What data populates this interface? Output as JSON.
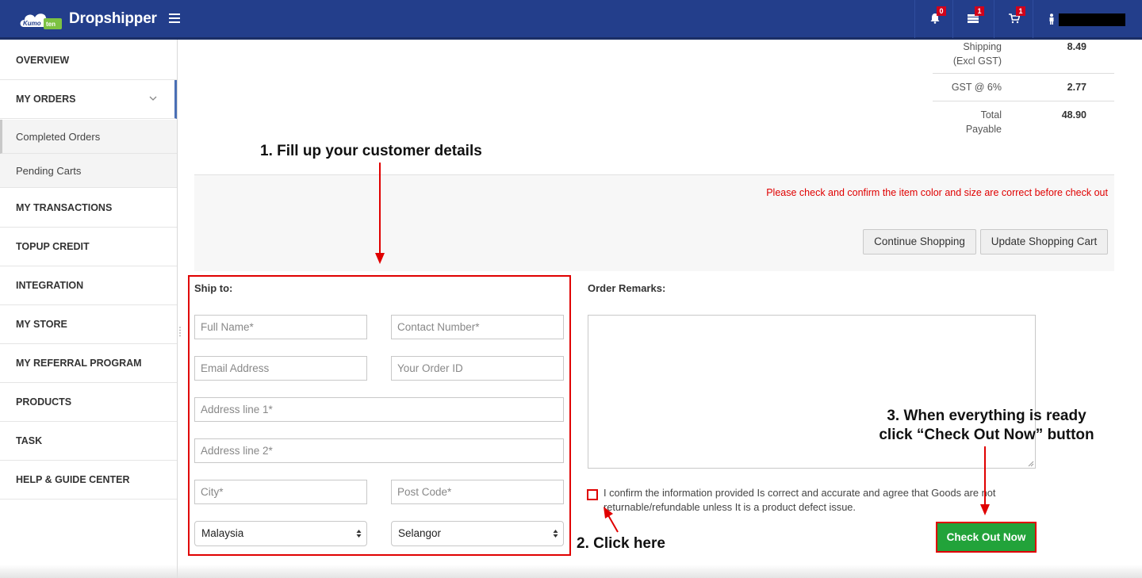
{
  "header": {
    "logo_text": "Kumoten",
    "brand": "Dropshipper",
    "notifications_count": "0",
    "messages_count": "1",
    "cart_count": "1"
  },
  "sidebar": {
    "items": [
      {
        "label": "OVERVIEW"
      },
      {
        "label": "MY ORDERS"
      },
      {
        "label": "MY TRANSACTIONS"
      },
      {
        "label": "TOPUP CREDIT"
      },
      {
        "label": "INTEGRATION"
      },
      {
        "label": "MY STORE"
      },
      {
        "label": "MY REFERRAL PROGRAM"
      },
      {
        "label": "PRODUCTS"
      },
      {
        "label": "TASK"
      },
      {
        "label": "HELP & GUIDE CENTER"
      }
    ],
    "sub_items": [
      {
        "label": "Completed Orders"
      },
      {
        "label": "Pending Carts"
      }
    ]
  },
  "totals": {
    "shipping_label_1": "Shipping",
    "shipping_label_2": "(Excl GST)",
    "shipping_value": "8.49",
    "gst_label": "GST @ 6%",
    "gst_value": "2.77",
    "total_label_1": "Total",
    "total_label_2": "Payable",
    "total_value": "48.90"
  },
  "cart": {
    "warning": "Please check and confirm the item color and size are correct before check out",
    "continue_label": "Continue Shopping",
    "update_label": "Update Shopping Cart"
  },
  "ship_to": {
    "title": "Ship to:",
    "full_name_ph": "Full Name*",
    "contact_ph": "Contact Number*",
    "email_ph": "Email Address",
    "order_id_ph": "Your Order ID",
    "address1_ph": "Address line 1*",
    "address2_ph": "Address line 2*",
    "city_ph": "City*",
    "postcode_ph": "Post Code*",
    "country": "Malaysia",
    "state": "Selangor"
  },
  "remarks": {
    "title": "Order Remarks:"
  },
  "confirm": {
    "text": "I confirm the information provided Is correct and accurate and agree that Goods are not returnable/refundable unless It is a product defect issue."
  },
  "checkout": {
    "label": "Check Out Now"
  },
  "annotations": {
    "step1": "1. Fill up your customer details",
    "step2": "2. Click here",
    "step3_line1": "3. When everything is ready",
    "step3_line2": "click “Check Out Now” button"
  },
  "colors": {
    "topbar": "#233e8b",
    "accent_red": "#e00000",
    "checkout_green": "#22a33a"
  }
}
